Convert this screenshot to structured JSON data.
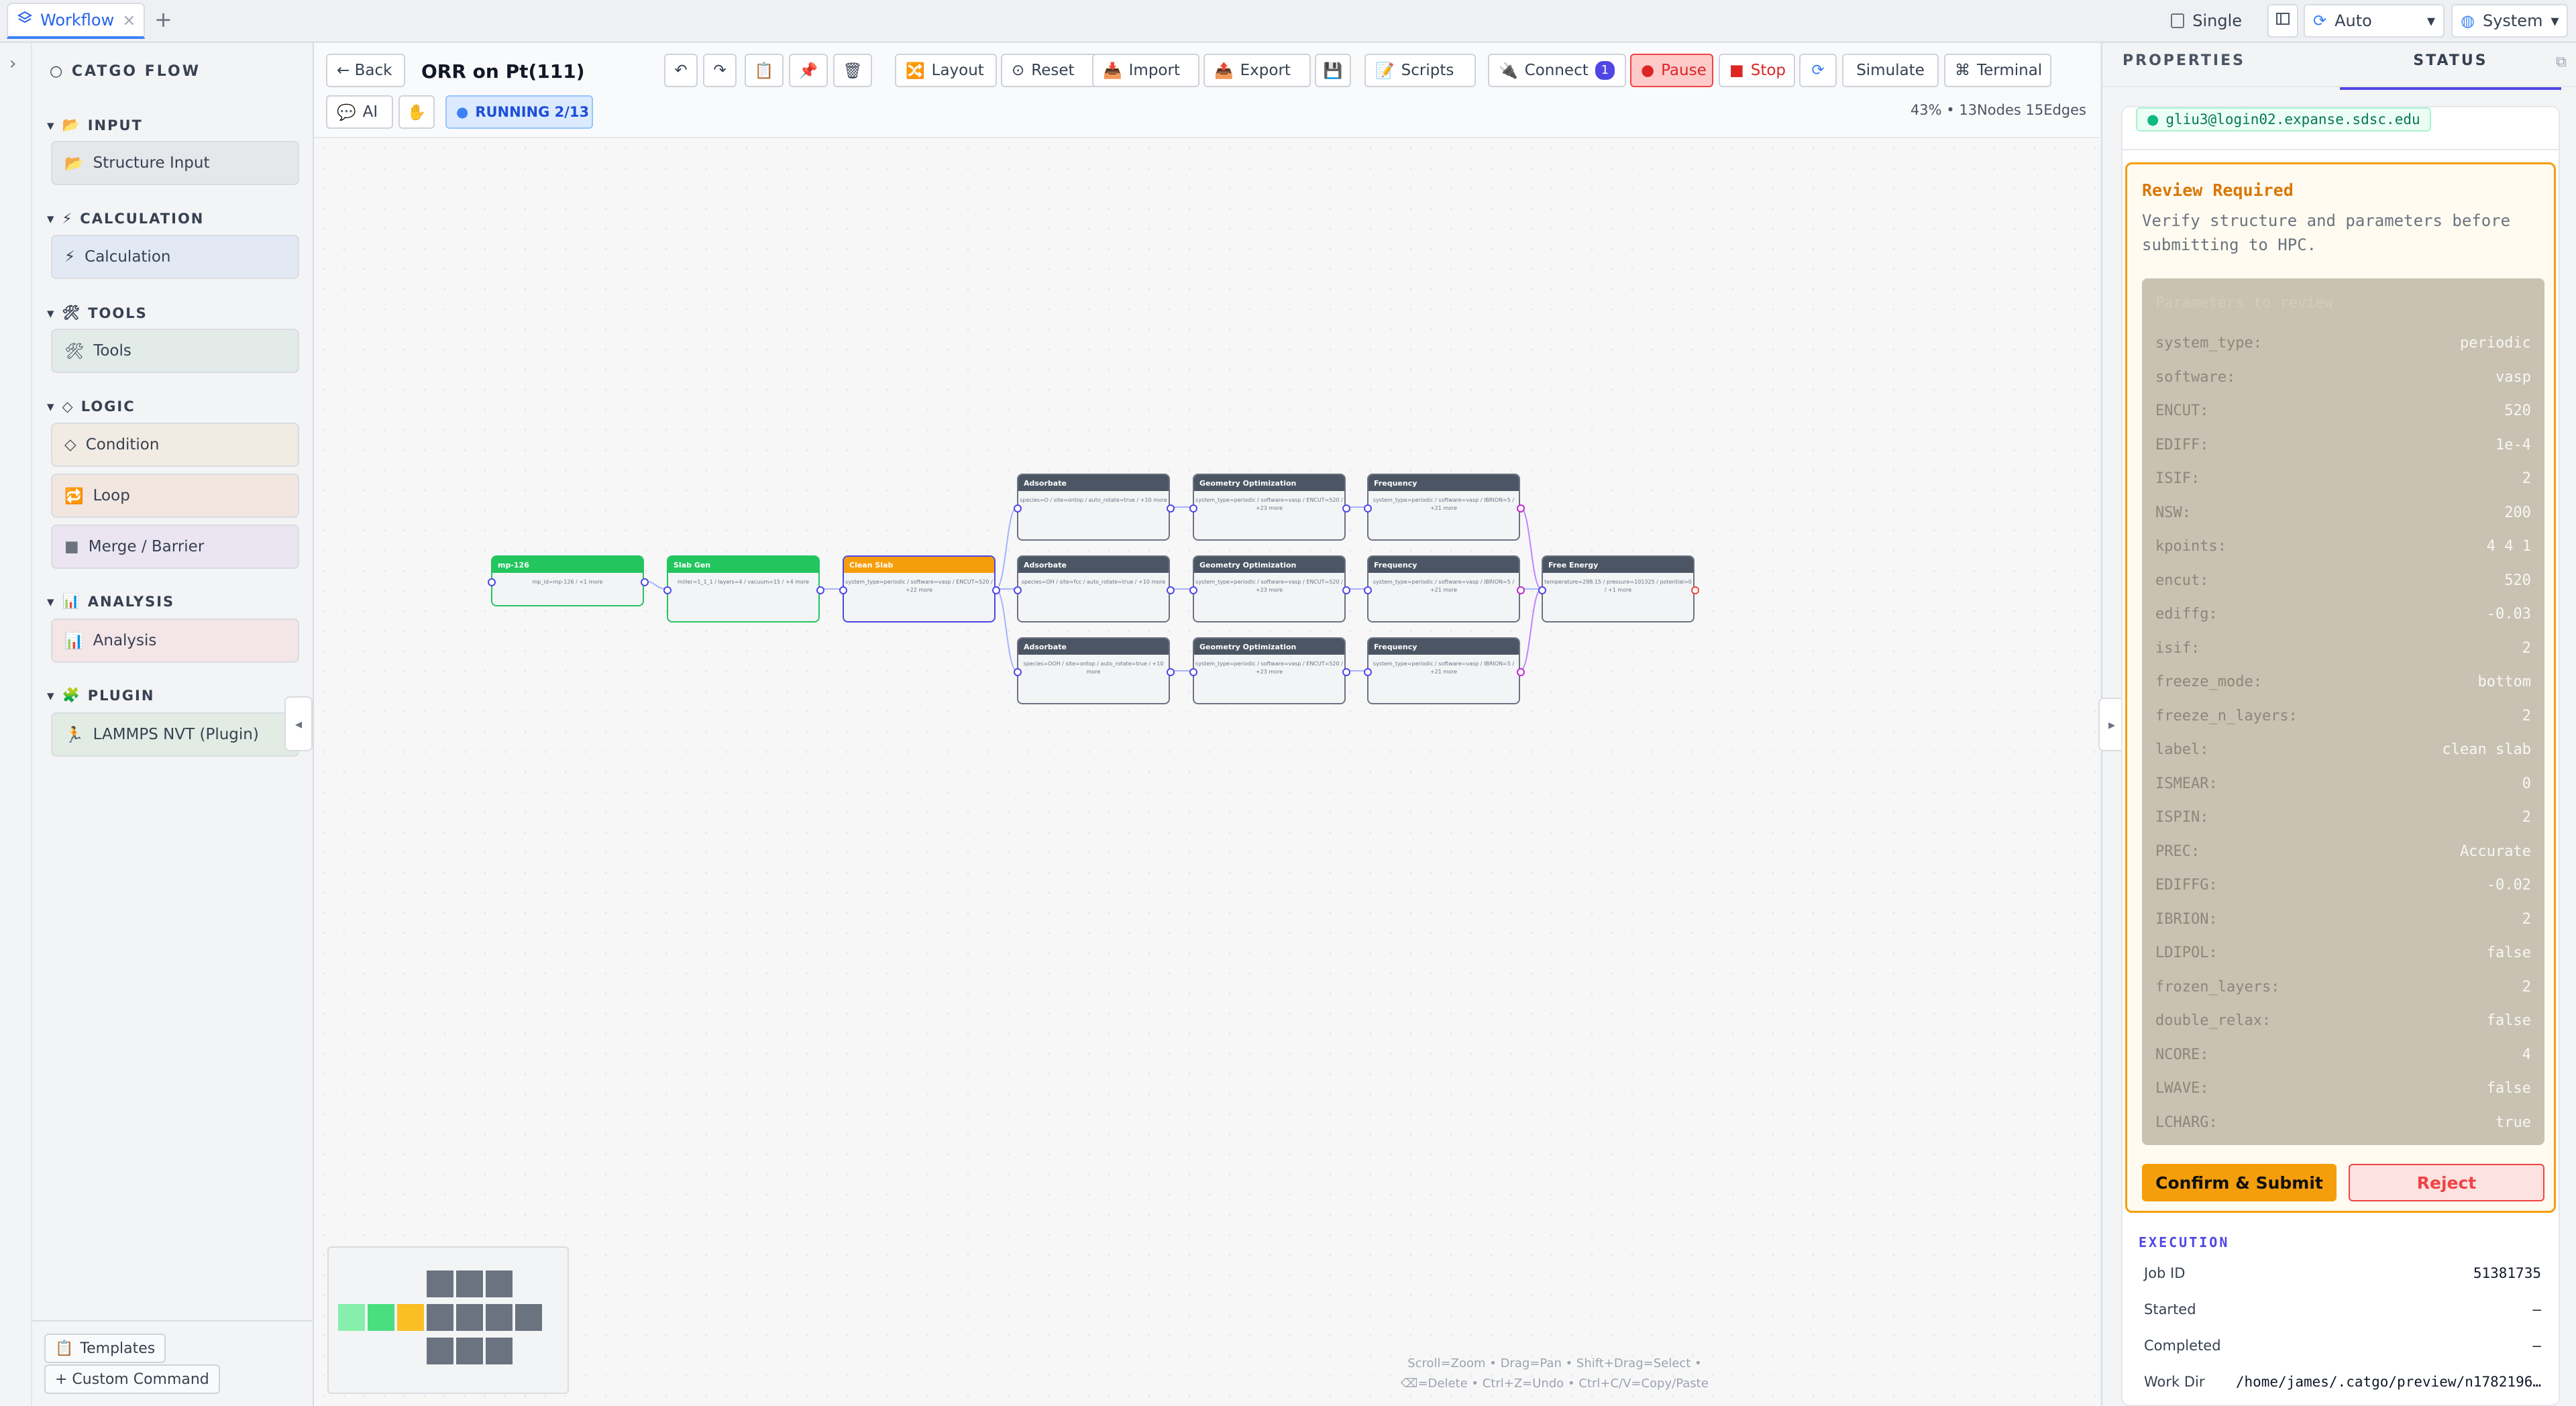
{
  "tabs": [
    {
      "label": "Workflow",
      "close": "×"
    }
  ],
  "tab_add": "+",
  "topright": {
    "single": "Single",
    "auto": "Auto",
    "system": "System"
  },
  "palette": {
    "title": "CATGO FLOW",
    "sections": [
      {
        "name": "INPUT",
        "icon": "📂",
        "items": [
          {
            "label": "Structure Input",
            "icon": "📂"
          }
        ]
      },
      {
        "name": "CALCULATION",
        "icon": "⚡",
        "items": [
          {
            "label": "Calculation",
            "icon": "⚡"
          }
        ]
      },
      {
        "name": "TOOLS",
        "icon": "🛠",
        "items": [
          {
            "label": "Tools",
            "icon": "🛠"
          }
        ]
      },
      {
        "name": "LOGIC",
        "icon": "◇",
        "items": [
          {
            "label": "Condition",
            "icon": "◇"
          },
          {
            "label": "Loop",
            "icon": "🔁"
          },
          {
            "label": "Merge / Barrier",
            "icon": "■"
          }
        ]
      },
      {
        "name": "ANALYSIS",
        "icon": "📊",
        "items": [
          {
            "label": "Analysis",
            "icon": "📊"
          }
        ]
      },
      {
        "name": "PLUGIN",
        "icon": "🧩",
        "items": [
          {
            "label": "LAMMPS NVT (Plugin)",
            "icon": "🏃"
          }
        ]
      }
    ],
    "footer": {
      "templates": "Templates",
      "custom_command": "+ Custom Command"
    }
  },
  "toolbar": {
    "back": "← Back",
    "title": "ORR on Pt(111)",
    "layout": "Layout",
    "reset": "Reset",
    "import": "Import",
    "export": "Export",
    "scripts": "Scripts",
    "connect": "Connect",
    "connect_count": "1",
    "pause": "Pause",
    "stop": "Stop",
    "simulate": "Simulate",
    "terminal": "Terminal",
    "ai": "AI",
    "status": "RUNNING 2/13",
    "stats": "43% • 13Nodes 15Edges"
  },
  "nodes": [
    {
      "title": "mp-126",
      "body": "mp_id=mp-126 / <1 more",
      "color": "#22c55e"
    },
    {
      "title": "Slab Gen",
      "body": "miller=1_1_1 / layers=4 / vacuum=15 / +4 more",
      "color": "#22c55e"
    },
    {
      "title": "Clean Slab",
      "body": "system_type=periodic / software=vasp / ENCUT=520 / +22 more",
      "color": "#f59e0b"
    },
    {
      "title": "Adsorbate",
      "body": "species=O / site=ontop / auto_rotate=true / +10 more",
      "color": "#4b5563"
    },
    {
      "title": "Adsorbate",
      "body": "species=OH / site=fcc / auto_rotate=true / +10 more",
      "color": "#4b5563"
    },
    {
      "title": "Adsorbate",
      "body": "species=OOH / site=ontop / auto_rotate=true / +10 more",
      "color": "#4b5563"
    },
    {
      "title": "Geometry Optimization",
      "body": "system_type=periodic / software=vasp / ENCUT=520 / +23 more",
      "color": "#4b5563"
    },
    {
      "title": "Geometry Optimization",
      "body": "system_type=periodic / software=vasp / ENCUT=520 / +23 more",
      "color": "#4b5563"
    },
    {
      "title": "Geometry Optimization",
      "body": "system_type=periodic / software=vasp / ENCUT=520 / +23 more",
      "color": "#4b5563"
    },
    {
      "title": "Frequency",
      "body": "system_type=periodic / software=vasp / IBRION=5 / +21 more",
      "color": "#4b5563"
    },
    {
      "title": "Frequency",
      "body": "system_type=periodic / software=vasp / IBRION=5 / +21 more",
      "color": "#4b5563"
    },
    {
      "title": "Frequency",
      "body": "system_type=periodic / software=vasp / IBRION=5 / +21 more",
      "color": "#4b5563"
    },
    {
      "title": "Free Energy",
      "body": "temperature=298.15 / pressure=101325 / potential=0 / +1 more",
      "color": "#4b5563"
    }
  ],
  "canvas_hint": [
    "Scroll=Zoom • Drag=Pan • Shift+Drag=Select •",
    "⌫=Delete • Ctrl+Z=Undo • Ctrl+C/V=Copy/Paste"
  ],
  "panel": {
    "tab_properties": "PROPERTIES",
    "tab_status": "STATUS",
    "host": "gliu3@login02.expanse.sdsc.edu",
    "review_title": "Review Required",
    "review_desc": "Verify structure and parameters before submitting to HPC.",
    "params_header": "Parameters to review",
    "params": [
      {
        "k": "system_type:",
        "v": "periodic"
      },
      {
        "k": "software:",
        "v": "vasp"
      },
      {
        "k": "ENCUT:",
        "v": "520"
      },
      {
        "k": "EDIFF:",
        "v": "1e-4"
      },
      {
        "k": "ISIF:",
        "v": "2"
      },
      {
        "k": "NSW:",
        "v": "200"
      },
      {
        "k": "kpoints:",
        "v": "4 4 1"
      },
      {
        "k": "encut:",
        "v": "520"
      },
      {
        "k": "ediffg:",
        "v": "-0.03"
      },
      {
        "k": "isif:",
        "v": "2"
      },
      {
        "k": "freeze_mode:",
        "v": "bottom"
      },
      {
        "k": "freeze_n_layers:",
        "v": "2"
      },
      {
        "k": "label:",
        "v": "clean slab"
      },
      {
        "k": "ISMEAR:",
        "v": "0"
      },
      {
        "k": "ISPIN:",
        "v": "2"
      },
      {
        "k": "PREC:",
        "v": "Accurate"
      },
      {
        "k": "EDIFFG:",
        "v": "-0.02"
      },
      {
        "k": "IBRION:",
        "v": "2"
      },
      {
        "k": "LDIPOL:",
        "v": "false"
      },
      {
        "k": "frozen_layers:",
        "v": "2"
      },
      {
        "k": "double_relax:",
        "v": "false"
      },
      {
        "k": "NCORE:",
        "v": "4"
      },
      {
        "k": "LWAVE:",
        "v": "false"
      },
      {
        "k": "LCHARG:",
        "v": "true"
      }
    ],
    "confirm": "Confirm & Submit",
    "reject": "Reject",
    "exec_title": "EXECUTION",
    "exec": [
      {
        "k": "Job ID",
        "v": "51381735"
      },
      {
        "k": "Started",
        "v": "—"
      },
      {
        "k": "Completed",
        "v": "—"
      },
      {
        "k": "Work Dir",
        "v": "/home/james/.catgo/preview/n1782196…"
      }
    ]
  }
}
